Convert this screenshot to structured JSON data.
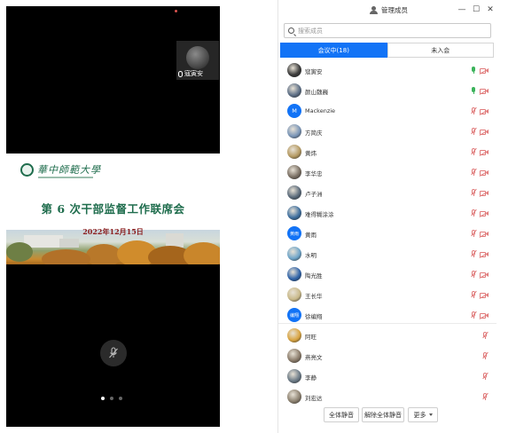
{
  "self_view": {
    "name": "寇寅安"
  },
  "slide": {
    "logo_text": "華中師範大學",
    "title": "第 6 次干部监督工作联席会",
    "date": "2022年12月15日"
  },
  "pager": {
    "pages": 3,
    "active": 0
  },
  "panel": {
    "title": "管理成员",
    "window_buttons": [
      "—",
      "☐",
      "✕"
    ],
    "search_placeholder": "搜索成员",
    "tabs": [
      {
        "label": "会议中(18)",
        "active": true
      },
      {
        "label": "未入会",
        "active": false
      }
    ],
    "participants": [
      {
        "name": "寇寅安",
        "avatar": "photo",
        "avatar_text": "",
        "color": "#3a3a3a",
        "mic": "on",
        "camera": "off"
      },
      {
        "name": "颜山魏巍",
        "avatar": "photo",
        "avatar_text": "",
        "color": "#5d6f86",
        "mic": "on",
        "camera": "off"
      },
      {
        "name": "Mackenzie",
        "avatar": "letter",
        "avatar_text": "M",
        "color": "#1273f6",
        "mic": "off",
        "camera": "off"
      },
      {
        "name": "方简庆",
        "avatar": "photo",
        "avatar_text": "",
        "color": "#7b96b8",
        "mic": "off",
        "camera": "off"
      },
      {
        "name": "黄炜",
        "avatar": "photo",
        "avatar_text": "",
        "color": "#b59a62",
        "mic": "off",
        "camera": "off"
      },
      {
        "name": "李华忠",
        "avatar": "photo",
        "avatar_text": "",
        "color": "#7a6f63",
        "mic": "off",
        "camera": "off"
      },
      {
        "name": "卢子洲",
        "avatar": "photo",
        "avatar_text": "",
        "color": "#5a6a7a",
        "mic": "off",
        "camera": "off"
      },
      {
        "name": "难得糊涂涂",
        "avatar": "photo",
        "avatar_text": "",
        "color": "#3d6e9e",
        "mic": "off",
        "camera": "off"
      },
      {
        "name": "黄雨",
        "avatar": "letter",
        "avatar_text": "黄雨",
        "color": "#1273f6",
        "mic": "off",
        "camera": "off"
      },
      {
        "name": "水明",
        "avatar": "photo",
        "avatar_text": "",
        "color": "#6fa5c9",
        "mic": "off",
        "camera": "off"
      },
      {
        "name": "陶光胜",
        "avatar": "photo",
        "avatar_text": "",
        "color": "#2f63a8",
        "mic": "off",
        "camera": "off"
      },
      {
        "name": "王长华",
        "avatar": "photo",
        "avatar_text": "",
        "color": "#c9b98a",
        "mic": "off",
        "camera": "off"
      },
      {
        "name": "徐编翔",
        "avatar": "letter",
        "avatar_text": "编翔",
        "color": "#1273f6",
        "mic": "off",
        "camera": "off"
      },
      {
        "name": "阿旺",
        "avatar": "photo",
        "avatar_text": "",
        "color": "#d9a441",
        "mic": "off",
        "camera": "none"
      },
      {
        "name": "燕亮文",
        "avatar": "photo",
        "avatar_text": "",
        "color": "#8a7b6a",
        "mic": "off",
        "camera": "none"
      },
      {
        "name": "李静",
        "avatar": "photo",
        "avatar_text": "",
        "color": "#6b7a86",
        "mic": "off",
        "camera": "none"
      },
      {
        "name": "刘宏达",
        "avatar": "photo",
        "avatar_text": "",
        "color": "#8c8170",
        "mic": "off",
        "camera": "none"
      }
    ],
    "footer": {
      "mute_all": "全体静音",
      "unmute_all": "解除全体静音",
      "more": "更多"
    }
  }
}
